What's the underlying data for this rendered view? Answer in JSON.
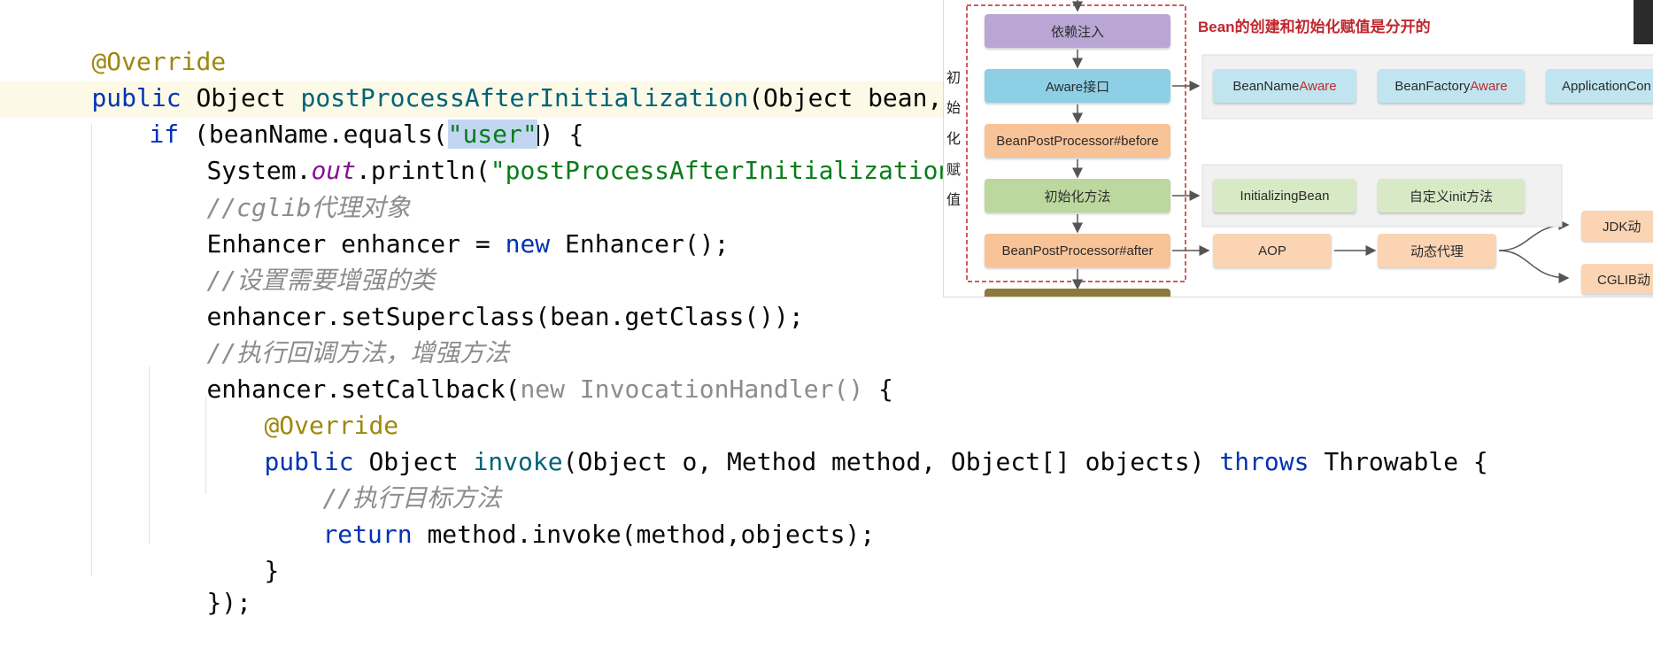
{
  "code": {
    "l1": {
      "ann": "@Override"
    },
    "l2": {
      "kw": "public",
      "type": "Object",
      "name": "postProcessAfterInitialization",
      "rest": "(Object bean, Strin"
    },
    "l3": {
      "kw": "if",
      "a": " (beanName.equals(",
      "str": "\"user\"",
      "b": ") {"
    },
    "l4": {
      "a": "System.",
      "fld": "out",
      "b": ".println(",
      "str": "\"postProcessAfterInitialization->use"
    },
    "l5": {
      "cmt": "//cglib代理对象"
    },
    "l6": {
      "a": "Enhancer enhancer = ",
      "kw": "new",
      "b": " Enhancer();"
    },
    "l7": {
      "cmt": "//设置需要增强的类"
    },
    "l8": {
      "a": "enhancer.setSuperclass(bean.getClass());"
    },
    "l9": {
      "cmt": "//执行回调方法，增强方法"
    },
    "l10": {
      "a": "enhancer.setCallback(",
      "gray": "new InvocationHandler()",
      "b": " {"
    },
    "l11": {
      "ann": "@Override"
    },
    "l12": {
      "kw": "public",
      "a": " Object ",
      "mth": "invoke",
      "b": "(Object o, Method method, Object[] objects) ",
      "kw2": "throws",
      "c": " Throwable {"
    },
    "l13": {
      "cmt": "//执行目标方法"
    },
    "l14": {
      "kw": "return",
      "a": " method.invoke(method,objects);"
    },
    "l15": {
      "a": "}"
    },
    "l16": {
      "a": "});"
    }
  },
  "diagram": {
    "title": "Bean的创建和初始化赋值是分开的",
    "side_label": [
      "初",
      "始",
      "化",
      "赋",
      "值"
    ],
    "steps": [
      "依赖注入",
      "Aware接口",
      "BeanPostProcessor#before",
      "初始化方法",
      "BeanPostProcessor#after"
    ],
    "aware": {
      "b1_pre": "BeanName",
      "b1_suf": "Aware",
      "b2_pre": "BeanFactory",
      "b2_suf": "Aware",
      "b3": "ApplicationCon"
    },
    "init": [
      "InitializingBean",
      "自定义init方法"
    ],
    "after": {
      "aop": "AOP",
      "proxy": "动态代理",
      "jdk": "JDK动",
      "cglib": "CGLIB动"
    },
    "colors": {
      "red": "#c0272d",
      "purple": "#b9a6d4",
      "blue": "#8dd0e6",
      "orange": "#f8c397",
      "green": "#bcd89e"
    }
  }
}
